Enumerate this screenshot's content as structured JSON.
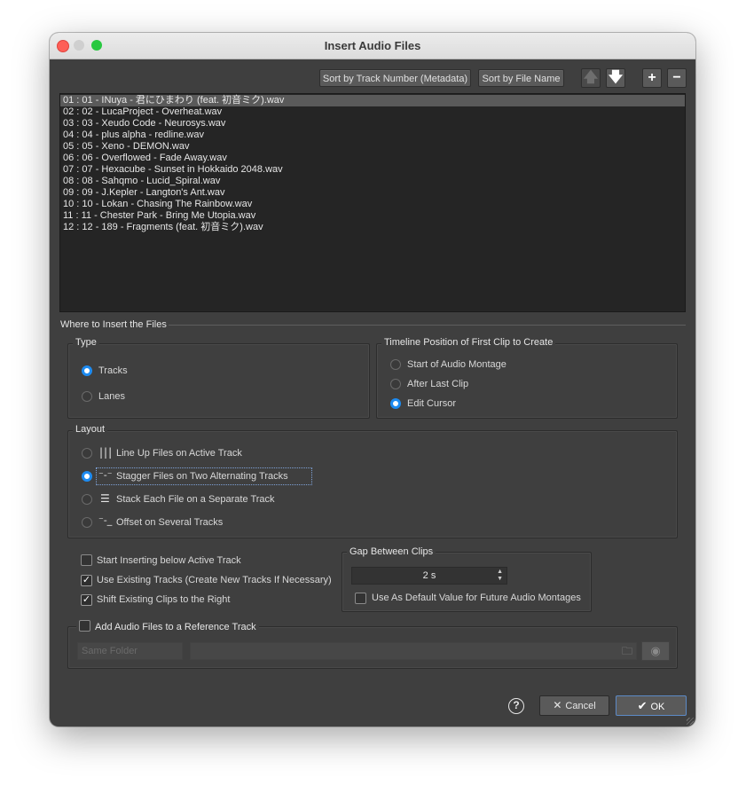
{
  "window": {
    "title": "Insert Audio Files"
  },
  "toolbar": {
    "sort_by_track_number": "Sort by Track Number (Metadata)",
    "sort_by_file_name": "Sort by File Name"
  },
  "files": [
    "01 : 01 - INuya - 君にひまわり (feat. 初音ミク).wav",
    "02 : 02 - LucaProject - Overheat.wav",
    "03 : 03 - Xeudo Code - Neurosys.wav",
    "04 : 04 - plus alpha - redline.wav",
    "05 : 05 - Xeno - DEMON.wav",
    "06 : 06 - Overflowed - Fade Away.wav",
    "07 : 07 - Hexacube - Sunset in Hokkaido 2048.wav",
    "08 : 08 - Sahqmo - Lucid_Spiral.wav",
    "09 : 09 - J.Kepler - Langton's Ant.wav",
    "10 : 10 - Lokan - Chasing The Rainbow.wav",
    "11 : 11 - Chester Park - Bring Me Utopia.wav",
    "12 : 12 - 189 - Fragments (feat. 初音ミク).wav"
  ],
  "where": {
    "title": "Where to Insert the Files",
    "type": {
      "label": "Type",
      "tracks": "Tracks",
      "lanes": "Lanes",
      "selected": "Tracks"
    },
    "timeline": {
      "label": "Timeline Position of First Clip to Create",
      "start": "Start of Audio Montage",
      "after_last": "After Last Clip",
      "edit_cursor": "Edit Cursor",
      "selected": "Edit Cursor"
    },
    "layout": {
      "label": "Layout",
      "line_up": "Line Up Files on Active Track",
      "stagger": "Stagger Files on Two Alternating Tracks",
      "stack": "Stack Each File on a Separate Track",
      "offset": "Offset on Several Tracks",
      "selected": "Stagger Files on Two Alternating Tracks"
    }
  },
  "options": {
    "start_below": {
      "label": "Start Inserting below Active Track",
      "checked": false
    },
    "use_existing": {
      "label": "Use Existing Tracks (Create New Tracks If Necessary)",
      "checked": true
    },
    "shift_existing": {
      "label": "Shift Existing Clips to the Right",
      "checked": true
    }
  },
  "gap": {
    "label": "Gap Between Clips",
    "value": "2 s",
    "default_label": "Use As Default Value for Future Audio Montages",
    "default_checked": false
  },
  "reference": {
    "label": "Add Audio Files to a Reference Track",
    "checked": false,
    "folder_option": "Same Folder"
  },
  "footer": {
    "help": "?",
    "cancel": "Cancel",
    "ok": "OK"
  },
  "colors": {
    "accent": "#1d8bf1",
    "panel": "#3f3f3f",
    "list_bg": "#252525"
  }
}
